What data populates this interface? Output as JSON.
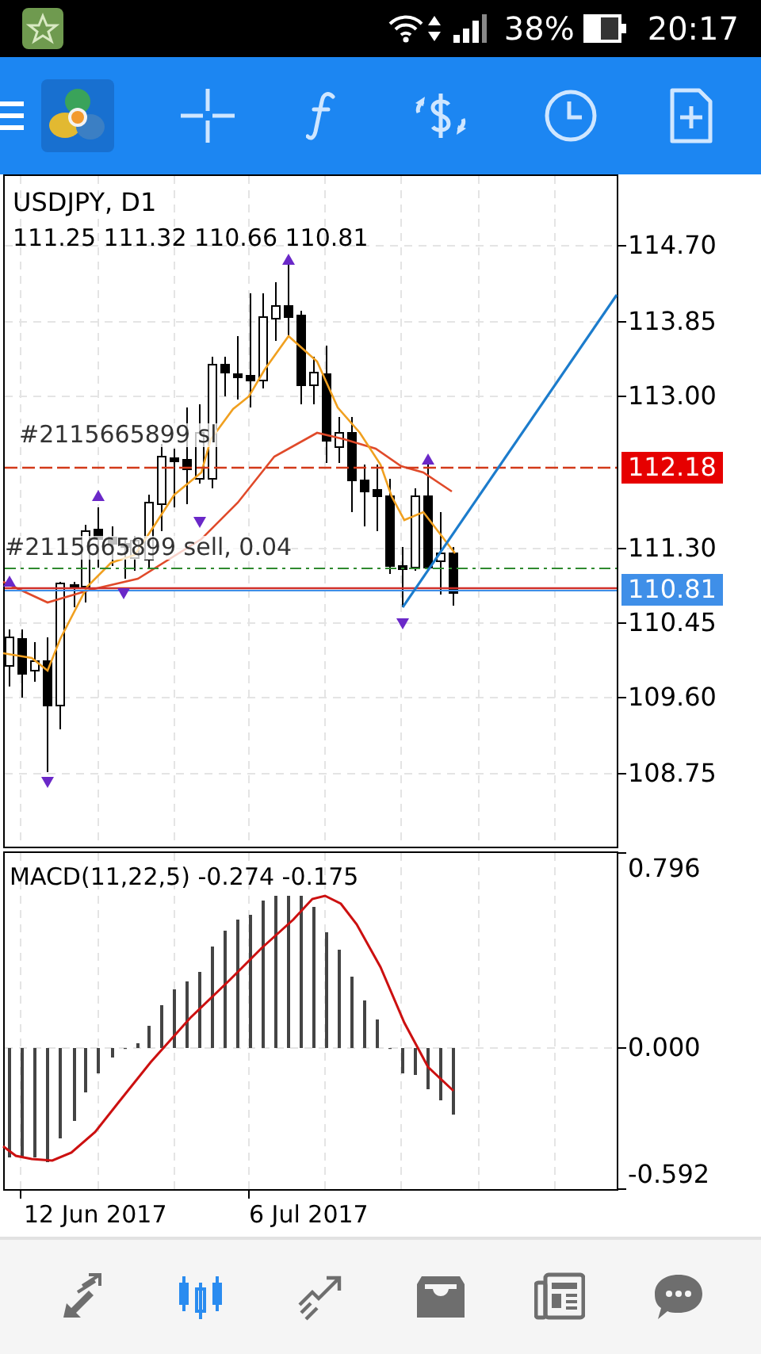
{
  "status_bar": {
    "battery": "38%",
    "time": "20:17"
  },
  "chart": {
    "symbol": "USDJPY, D1",
    "ohlc": "111.25 111.32 110.66 110.81",
    "price_scale": [
      "114.70",
      "113.85",
      "113.00",
      "111.30",
      "110.45",
      "109.60",
      "108.75"
    ],
    "price_badges": [
      {
        "label": "112.18",
        "color": "#e60000"
      },
      {
        "label": "110.81",
        "color": "#3f8fe8"
      }
    ],
    "order_labels": [
      "#2115665899 sl",
      "#2115665899 sell, 0.04"
    ]
  },
  "macd": {
    "title": "MACD(11,22,5) -0.274 -0.175",
    "scale": [
      "0.796",
      "0.000",
      "-0.592"
    ]
  },
  "time_axis": [
    "12 Jun 2017",
    "6 Jul 2017"
  ],
  "bottom_nav": [
    {
      "selected": false
    },
    {
      "selected": true
    },
    {
      "selected": false
    },
    {
      "selected": false
    },
    {
      "selected": false
    },
    {
      "selected": false
    }
  ]
}
